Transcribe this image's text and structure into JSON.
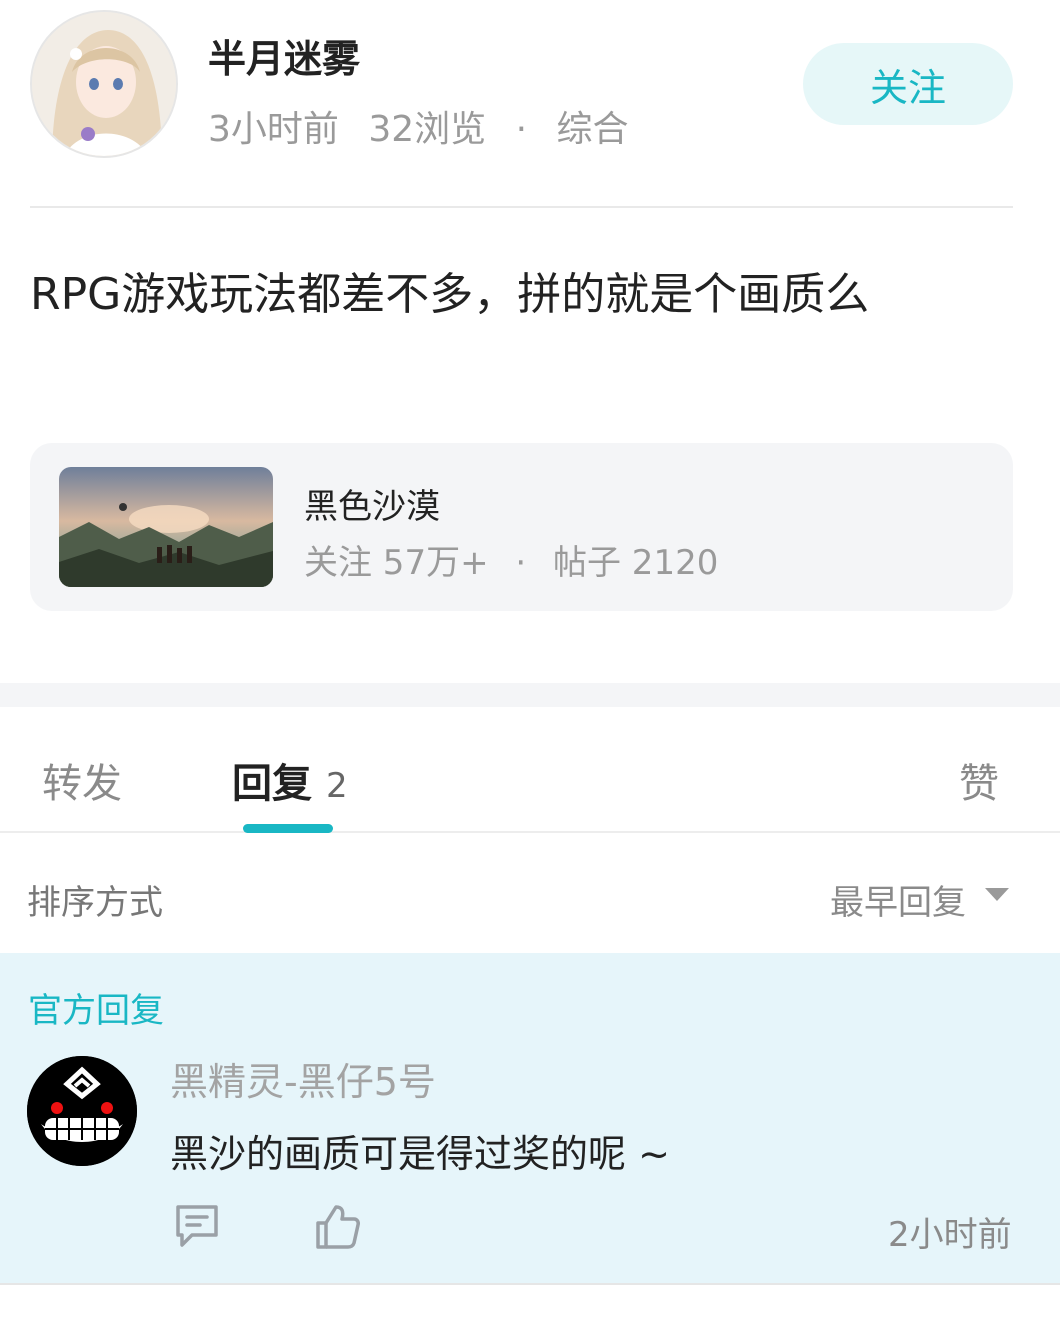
{
  "author": {
    "name": "半月迷雾",
    "time": "3小时前",
    "views": "32浏览",
    "separator": "·",
    "category": "综合",
    "follow_label": "关注"
  },
  "post": {
    "text": "RPG游戏玩法都差不多，拼的就是个画质么"
  },
  "game_card": {
    "name": "黑色沙漠",
    "followers": "关注 57万+",
    "separator": "·",
    "posts": "帖子 2120"
  },
  "tabs": {
    "forward": "转发",
    "reply": "回复",
    "reply_count": "2",
    "like": "赞"
  },
  "sort": {
    "label": "排序方式",
    "value": "最早回复"
  },
  "official_reply": {
    "label": "官方回复",
    "user": "黑精灵-黑仔5号",
    "text": "黑沙的画质可是得过奖的呢 ~",
    "time": "2小时前"
  },
  "colors": {
    "accent": "#19b7c4",
    "official_bg": "#e6f5fa",
    "card_bg": "#f4f5f7"
  },
  "icons": [
    "avatar-image",
    "game-thumbnail",
    "chevron-down-icon",
    "comment-icon",
    "thumbs-up-icon"
  ]
}
